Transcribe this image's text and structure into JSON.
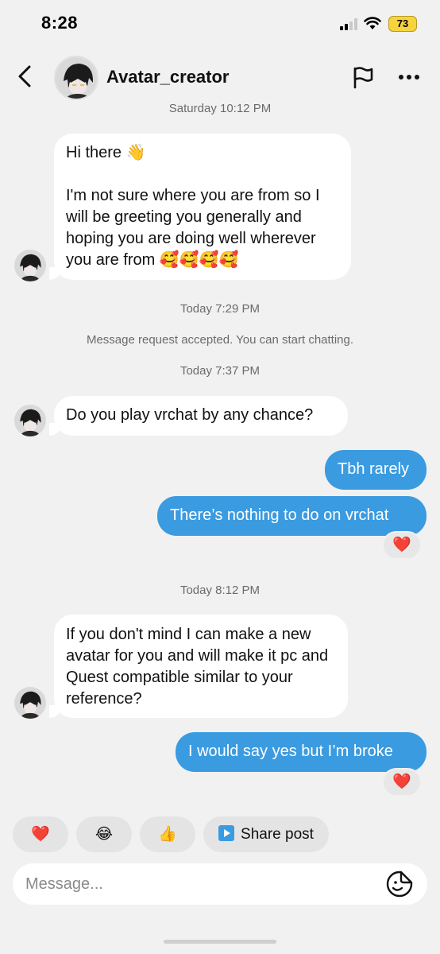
{
  "status_bar": {
    "time": "8:28",
    "battery": "73"
  },
  "header": {
    "username": "Avatar_creator",
    "flag_icon": "flag-icon",
    "more_icon": "more-dots-icon",
    "back_icon": "chevron-left-icon"
  },
  "conversation": {
    "timestamp_top": "Saturday 10:12 PM",
    "msg1": "Hi there 👋\n\nI'm not sure where you are from so I will be greeting you generally and hoping you are doing well wherever you are from 🥰🥰🥰🥰",
    "timestamp_2": "Today 7:29 PM",
    "system_msg": "Message request accepted. You can start chatting.",
    "timestamp_3": "Today 7:37 PM",
    "msg2": "Do you play vrchat by any chance?",
    "msg3": "Tbh rarely",
    "msg4": "There’s nothing to do on vrchat",
    "reaction1": "❤️",
    "timestamp_4": "Today 8:12 PM",
    "msg5": "If you don't mind I can make a new avatar for you and will make it pc and Quest compatible similar to your reference?",
    "msg6": "I would say yes but I’m broke",
    "reaction2": "❤️"
  },
  "quick_replies": {
    "heart": "❤️",
    "laugh": "😂",
    "thumbs": "👍",
    "share_label": "Share post"
  },
  "composer": {
    "placeholder": "Message..."
  },
  "colors": {
    "outgoing_bubble": "#3a9be0",
    "background": "#f1f1f2",
    "incoming_bubble": "#ffffff"
  }
}
